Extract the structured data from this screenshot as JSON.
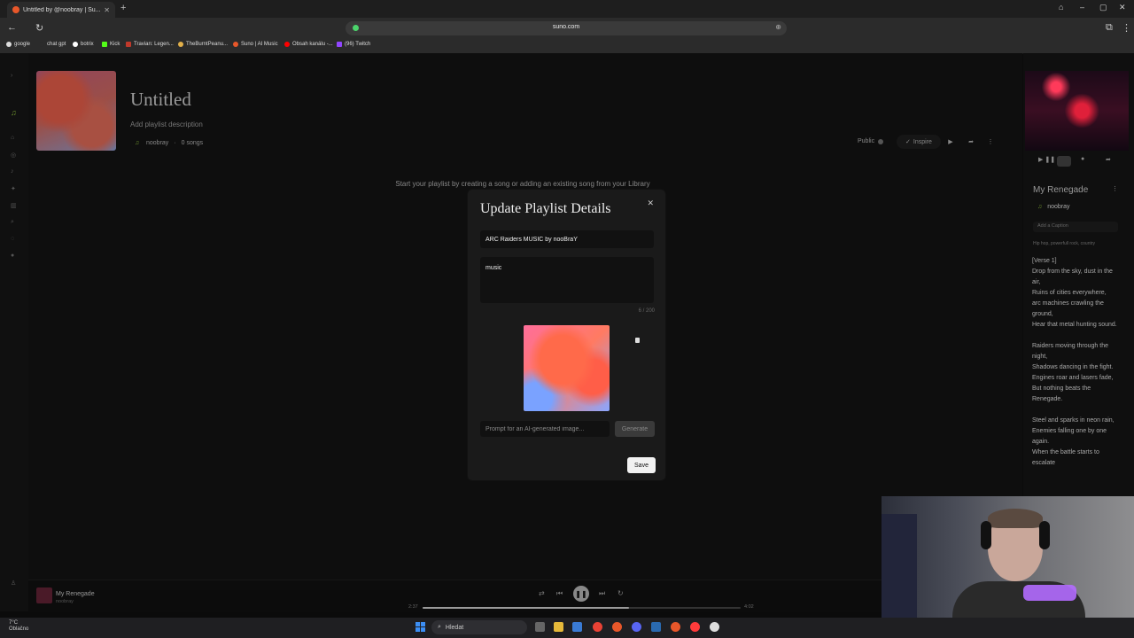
{
  "browser": {
    "tab_title": "Untitled by @noobray | Su...",
    "url": "suno.com",
    "bookmarks": [
      "google",
      "chat gpt",
      "botrix",
      "Kick",
      "Travian: Legen...",
      "TheBurntPeanu...",
      "Suno | AI Music",
      "Obsah kanálu -...",
      "(96) Twitch"
    ]
  },
  "playlist": {
    "title": "Untitled",
    "description_placeholder": "Add playlist description",
    "owner": "noobray",
    "song_count": "0 songs",
    "public_label": "Public",
    "inspire_label": "Inspire",
    "empty_message": "Start your playlist by creating a song or adding an existing song from your Library"
  },
  "dialog": {
    "title": "Update Playlist Details",
    "name_value": "ARC Raiders MUSIC by nooBraY",
    "description_value": "music",
    "char_count": "6 / 200",
    "prompt_placeholder": "Prompt for an AI-generated image...",
    "generate_label": "Generate",
    "save_label": "Save"
  },
  "now_playing_panel": {
    "title": "My Renegade",
    "user": "noobray",
    "caption_placeholder": "Add a Caption",
    "tags": "Hip hop, powerfull rock, country",
    "lyrics": "[Verse 1]\nDrop from the sky, dust in the air,\nRuins of cities everywhere,\narc machines crawling the ground,\nHear that metal hunting sound.\n\nRaiders moving through the night,\nShadows dancing in the fight.\nEngines roar and lasers fade,\nBut nothing beats the Renegade.\n\nSteel and sparks in neon rain,\nEnemies falling one by one again.\nWhen the battle starts to escalate"
  },
  "player": {
    "song": "My Renegade",
    "artist": "noobray",
    "time_elapsed": "2:37",
    "time_total": "4:02",
    "progress": 0.65
  },
  "taskbar": {
    "weather_temp": "7°C",
    "weather_desc": "Oblačno",
    "search_label": "Hledat"
  },
  "colors": {
    "accent_green": "#6b8f2c",
    "background": "#0b0b0b",
    "dialog_bg": "#1a1a1a"
  }
}
